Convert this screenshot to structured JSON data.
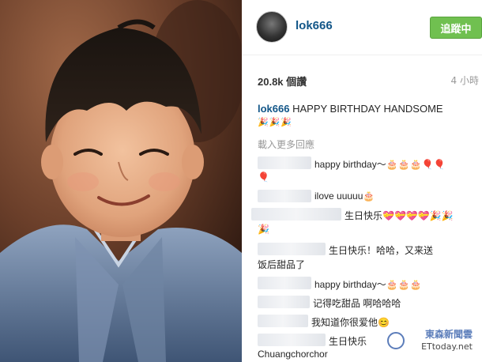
{
  "post": {
    "username": "lok666",
    "follow_label": "追蹤中",
    "likes": "20.8k 個讚",
    "time": "4 小時",
    "caption": {
      "user": "lok666",
      "text": "HAPPY BIRTHDAY HANDSOME",
      "emoji": "🎉🎉🎉"
    },
    "load_more": "載入更多回應",
    "comments": [
      {
        "text": "happy birthday～🎂🎂🎂🎈🎈"
      },
      {
        "text": "🎈"
      },
      {
        "text": "ilove uuuuu🎂"
      },
      {
        "text": "生日快乐💝💝💝💝🎉🎉"
      },
      {
        "text": "🎉"
      },
      {
        "text": "生日快乐！哈哈，又来送"
      },
      {
        "text": "饭后甜品了"
      },
      {
        "text": "happy birthday～🎂🎂🎂"
      },
      {
        "text": "记得吃甜品 啊哈哈哈"
      },
      {
        "text": "我知道你很爱他😊"
      },
      {
        "text": "生日快乐"
      },
      {
        "text": "Chuangchorchor"
      }
    ]
  },
  "watermark": {
    "line1": "東森新聞雲",
    "line2": "ETtoday.net"
  },
  "colors": {
    "username": "#125688",
    "follow_button": "#70c050",
    "muted": "#999999"
  }
}
